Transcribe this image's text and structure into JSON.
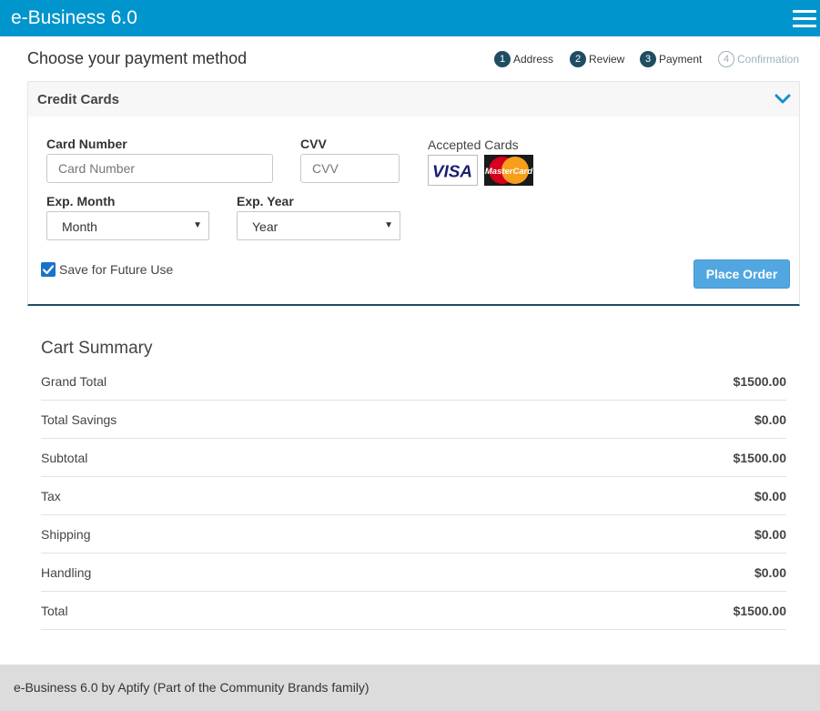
{
  "header": {
    "brand": "e-Business 6.0",
    "menu_icon": "hamburger-icon"
  },
  "page": {
    "title": "Choose your payment method"
  },
  "steps": [
    {
      "number": "1",
      "label": "Address",
      "active": true
    },
    {
      "number": "2",
      "label": "Review",
      "active": true
    },
    {
      "number": "3",
      "label": "Payment",
      "active": true
    },
    {
      "number": "4",
      "label": "Confirmation",
      "active": false
    }
  ],
  "payment": {
    "section_title": "Credit Cards",
    "card_number_label": "Card Number",
    "card_number_placeholder": "Card Number",
    "card_number_value": "",
    "cvv_label": "CVV",
    "cvv_placeholder": "CVV",
    "cvv_value": "",
    "accepted_label": "Accepted Cards",
    "accepted_cards": [
      "VISA",
      "MasterCard"
    ],
    "exp_month_label": "Exp. Month",
    "exp_month_selected": "Month",
    "exp_year_label": "Exp. Year",
    "exp_year_selected": "Year",
    "save_label": "Save for Future Use",
    "save_checked": true,
    "place_order_label": "Place Order"
  },
  "cart": {
    "title": "Cart Summary",
    "rows": [
      {
        "label": "Grand Total",
        "value": "$1500.00"
      },
      {
        "label": "Total Savings",
        "value": "$0.00"
      },
      {
        "label": "Subtotal",
        "value": "$1500.00"
      },
      {
        "label": "Tax",
        "value": "$0.00"
      },
      {
        "label": "Shipping",
        "value": "$0.00"
      },
      {
        "label": "Handling",
        "value": "$0.00"
      },
      {
        "label": "Total",
        "value": "$1500.00"
      }
    ]
  },
  "footer": {
    "text": "e-Business 6.0 by Aptify (Part of the Community Brands family)"
  },
  "colors": {
    "header_bg": "#0095cc",
    "step_active": "#1f4e63",
    "step_inactive": "#9bb3bf",
    "button": "#52a7e0",
    "checkbox": "#1a73c9"
  }
}
